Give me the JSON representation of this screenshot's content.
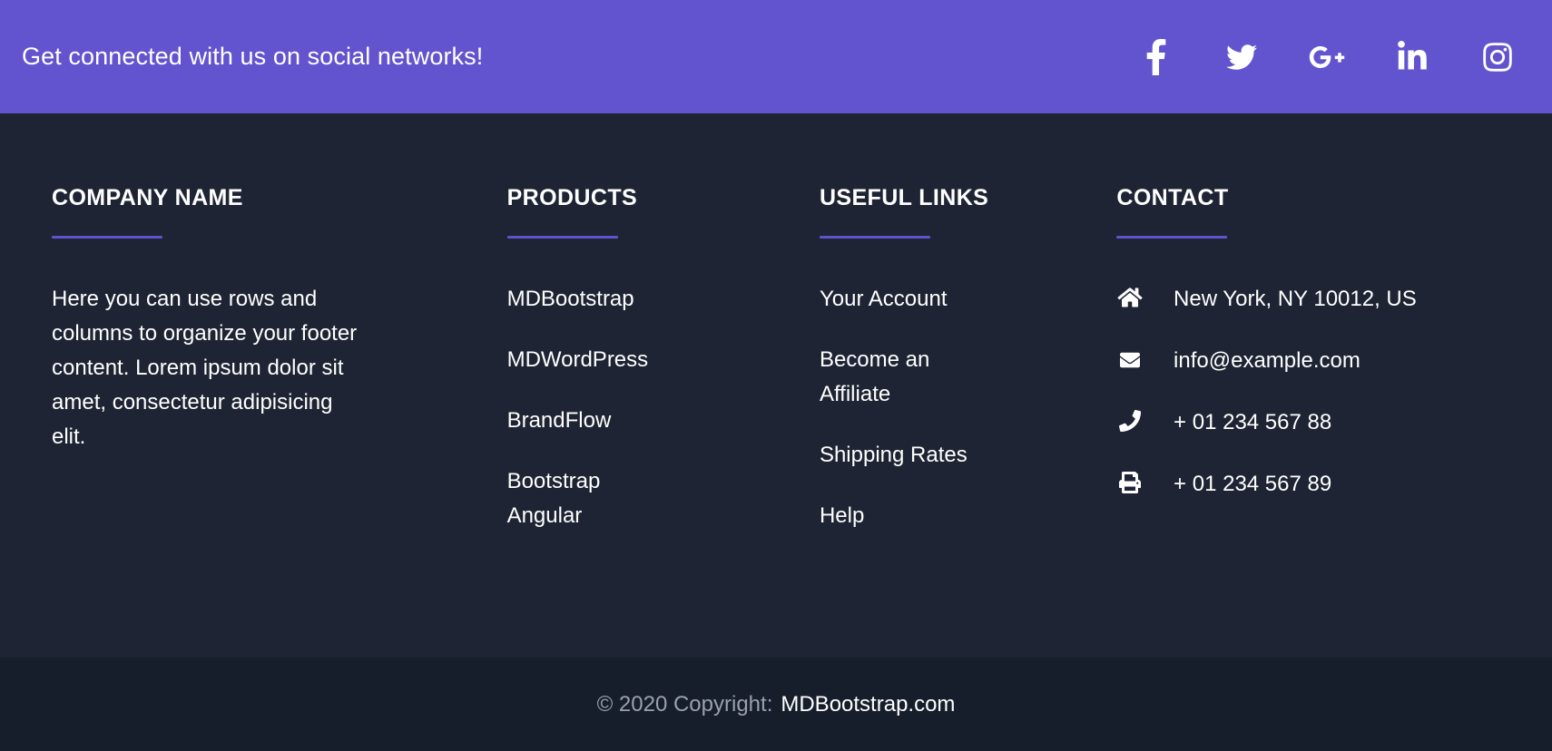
{
  "theme": {
    "accent_purple": "#6154ce",
    "rule_purple": "#5f52cd",
    "footer_bg": "#1e2433",
    "copyright_bg": "#161d2b",
    "text_white": "#ffffff",
    "text_muted": "#9aa0ad"
  },
  "social_bar": {
    "tagline": "Get connected with us on social networks!",
    "icons": [
      {
        "name": "facebook-icon",
        "label": "Facebook"
      },
      {
        "name": "twitter-icon",
        "label": "Twitter"
      },
      {
        "name": "google-plus-icon",
        "label": "Google Plus"
      },
      {
        "name": "linkedin-icon",
        "label": "LinkedIn"
      },
      {
        "name": "instagram-icon",
        "label": "Instagram"
      }
    ]
  },
  "columns": {
    "company": {
      "title": "Company name",
      "body": "Here you can use rows and columns to organize your footer content. Lorem ipsum dolor sit amet, consectetur adipisicing elit."
    },
    "products": {
      "title": "Products",
      "items": [
        {
          "label": "MDBootstrap"
        },
        {
          "label": "MDWordPress"
        },
        {
          "label": "BrandFlow"
        },
        {
          "label": "Bootstrap Angular"
        }
      ]
    },
    "useful_links": {
      "title": "Useful links",
      "items": [
        {
          "label": "Your Account"
        },
        {
          "label": "Become an Affiliate"
        },
        {
          "label": "Shipping Rates"
        },
        {
          "label": "Help"
        }
      ]
    },
    "contact": {
      "title": "Contact",
      "items": [
        {
          "icon": "home-icon",
          "text": "New York, NY 10012, US"
        },
        {
          "icon": "envelope-icon",
          "text": "info@example.com"
        },
        {
          "icon": "phone-icon",
          "text": "+ 01 234 567 88"
        },
        {
          "icon": "printer-icon",
          "text": "+ 01 234 567 89"
        }
      ]
    }
  },
  "copyright": {
    "prefix": "© 2020 Copyright:",
    "link": "MDBootstrap.com"
  }
}
